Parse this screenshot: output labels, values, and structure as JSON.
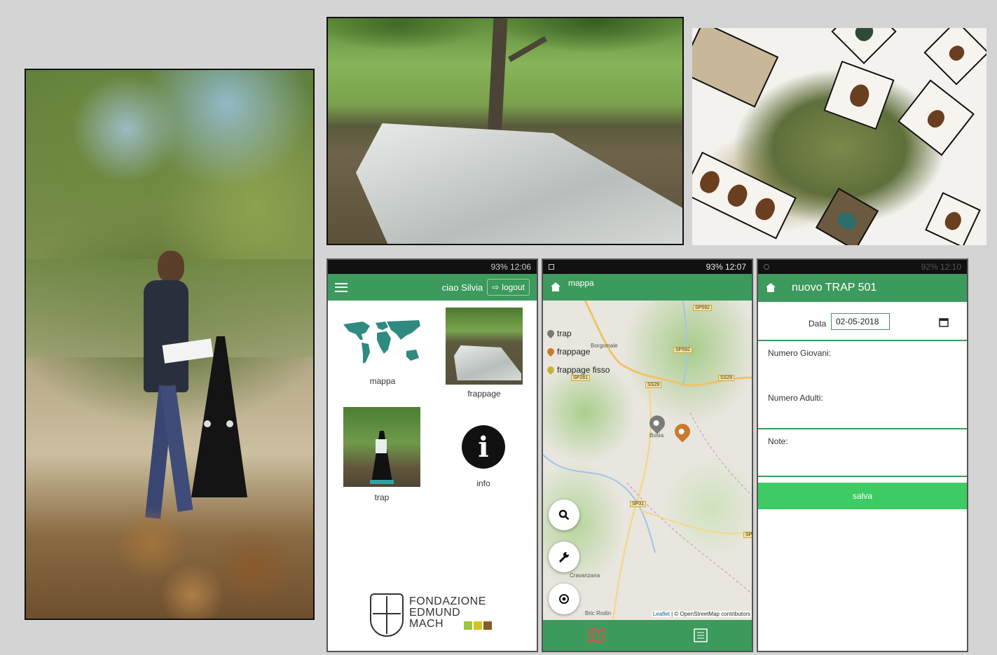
{
  "home_screen": {
    "status": "93% 12:06",
    "greeting": "ciao Silvia",
    "logout_label": "logout",
    "menu": {
      "mappa": "mappa",
      "frappage": "frappage",
      "trap": "trap",
      "info": "info"
    },
    "logo": {
      "line1": "FONDAZIONE",
      "line2": "EDMUND",
      "line3": "MACH",
      "colors": [
        "#9bc83a",
        "#d7c21f",
        "#8a5a2b"
      ]
    }
  },
  "map_screen": {
    "status": "93% 12:07",
    "title": "mappa",
    "legend": [
      {
        "label": "trap",
        "color": "#777777"
      },
      {
        "label": "frappage",
        "color": "#c87b2b"
      },
      {
        "label": "frappage fisso",
        "color": "#c9b23a"
      }
    ],
    "places": {
      "borgomale": "Borgomale",
      "bosia": "Bosia",
      "cravanzana": "Cravanzana",
      "bric_rodin": "Bric Rodin"
    },
    "roads": {
      "sp592a": "SP592",
      "sp592b": "SP592",
      "sp281": "SP281",
      "ss29a": "SS29",
      "ss29b": "SS29",
      "sp31": "SP31",
      "sp_edge": "SP"
    },
    "attribution_link": "Leaflet",
    "attribution_text": "| © OpenStreetMap contributors"
  },
  "form_screen": {
    "status": "92% 12:10",
    "title": "nuovo TRAP 501",
    "date_label": "Data",
    "date_value": "02-05-2018",
    "giovani_label": "Numero Giovani:",
    "adulti_label": "Numero Adulti:",
    "note_label": "Note:",
    "save_label": "salva"
  },
  "colors": {
    "brand_green": "#3b9a5c",
    "save_green": "#3ecb63"
  }
}
